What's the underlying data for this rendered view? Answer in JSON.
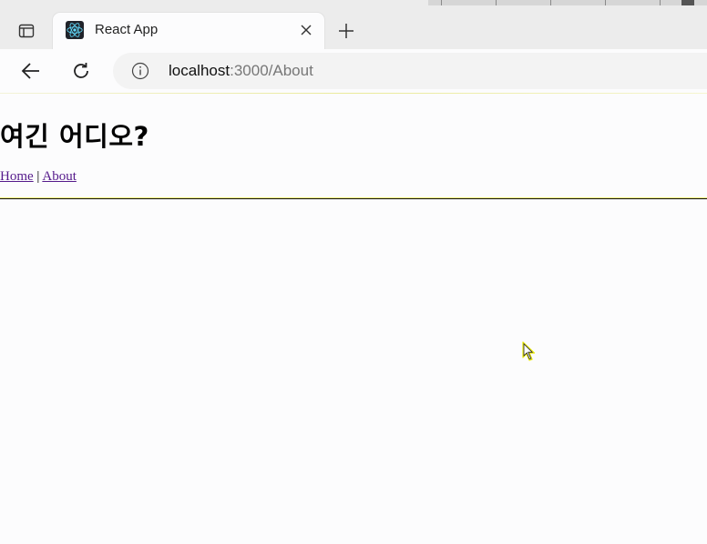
{
  "tab": {
    "title": "React App",
    "favicon": "react-logo-icon"
  },
  "address_bar": {
    "host": "localhost",
    "path": ":3000/About"
  },
  "page": {
    "heading": "여긴 어디오?",
    "nav": {
      "home": "Home",
      "separator": " | ",
      "about": "About"
    }
  },
  "colors": {
    "link_visited": "#551a8b",
    "tab_bg": "#fcfcfd",
    "tabstrip_bg": "#ececec"
  }
}
